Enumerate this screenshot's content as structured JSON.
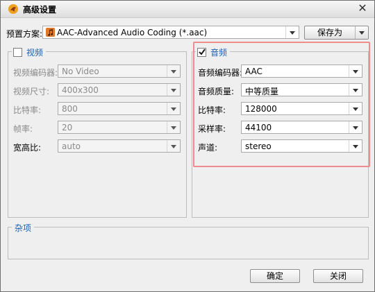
{
  "window": {
    "title": "高级设置"
  },
  "preset": {
    "label": "预置方案:",
    "value": "AAC-Advanced Audio Coding (*.aac)",
    "save_as": "保存为"
  },
  "video": {
    "legend": "视频",
    "checked": false,
    "rows": [
      {
        "label": "视频编码器:",
        "value": "No Video"
      },
      {
        "label": "视频尺寸:",
        "value": "400x300"
      },
      {
        "label": "比特率:",
        "value": "800"
      },
      {
        "label": "帧率:",
        "value": "20"
      },
      {
        "label": "宽高比:",
        "value": "auto"
      }
    ]
  },
  "audio": {
    "legend": "音频",
    "checked": true,
    "rows": [
      {
        "label": "音频编码器:",
        "value": "AAC"
      },
      {
        "label": "音频质量:",
        "value": "中等质量"
      },
      {
        "label": "比特率:",
        "value": "128000"
      },
      {
        "label": "采样率:",
        "value": "44100"
      },
      {
        "label": "声道:",
        "value": "stereo"
      }
    ]
  },
  "misc": {
    "legend": "杂项"
  },
  "footer": {
    "ok": "确定",
    "close": "关闭"
  },
  "colors": {
    "legend": "#1f5fae",
    "highlight": "#ef8c8c"
  }
}
